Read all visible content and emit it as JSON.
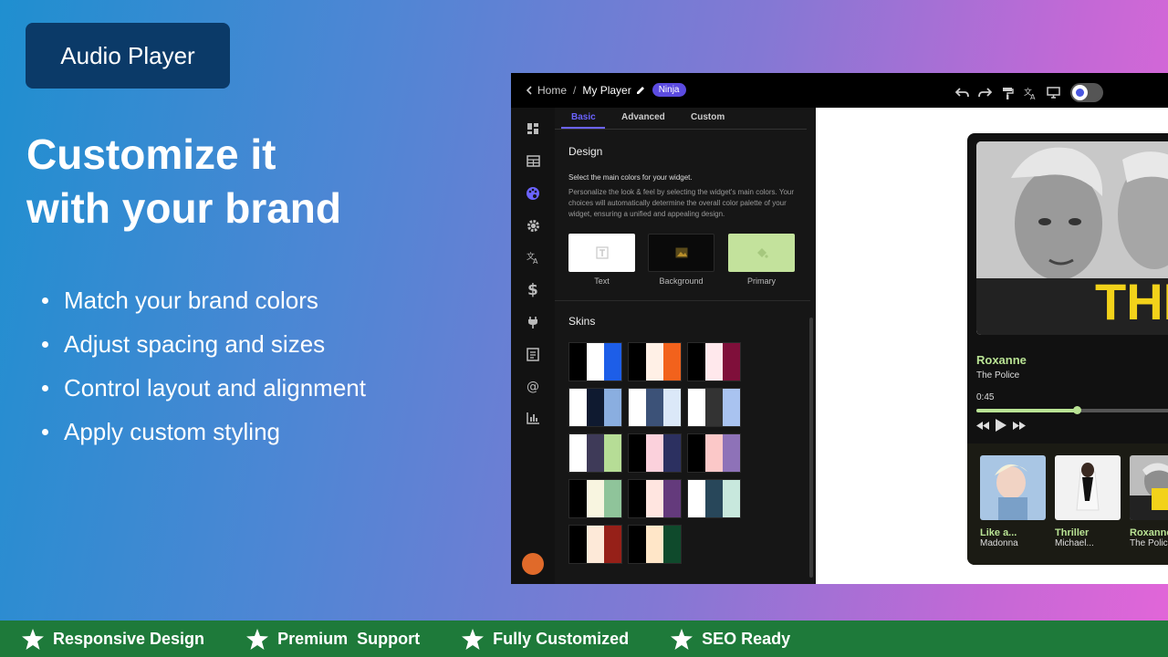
{
  "badge": {
    "label": "Audio Player"
  },
  "headline": {
    "line1": "Customize it",
    "line2": "with your brand"
  },
  "bullets": [
    "Match your brand colors",
    "Adjust spacing and sizes",
    "Control layout and alignment",
    "Apply custom styling"
  ],
  "footer": {
    "features": [
      "Responsive Design",
      "Premium  Support",
      "Fully Customized",
      "SEO Ready"
    ]
  },
  "app": {
    "breadcrumb": {
      "home": "Home",
      "separator": "/",
      "current": "My Player",
      "plan_badge": "Ninja"
    },
    "toolbar_icons": [
      "undo-icon",
      "redo-icon",
      "paint-roller-icon",
      "translate-icon",
      "desktop-icon",
      "dark-mode-toggle"
    ],
    "sidebar_icons": [
      "dashboard-icon",
      "layout-icon",
      "palette-icon",
      "gear-icon",
      "translate-icon",
      "dollar-icon",
      "plug-icon",
      "form-icon",
      "at-icon",
      "analytics-icon"
    ],
    "tabs": [
      "Basic",
      "Advanced",
      "Custom"
    ],
    "active_tab": "Basic",
    "design": {
      "title": "Design",
      "subtitle": "Select the main colors for your widget.",
      "description": "Personalize the look & feel by selecting the widget's main colors. Your choices will automatically determine the overall color palette of your widget, ensuring a unified and appealing design.",
      "swatches": [
        {
          "label": "Text",
          "color": "#ffffff"
        },
        {
          "label": "Background",
          "color": "#0a0a0a"
        },
        {
          "label": "Primary",
          "color": "#c3e29c"
        }
      ]
    },
    "skins": {
      "title": "Skins",
      "palettes": [
        [
          "#000000",
          "#ffffff",
          "#1d5ee8"
        ],
        [
          "#000000",
          "#fff0e6",
          "#f2621c"
        ],
        [
          "#000000",
          "#ffe8ec",
          "#7f0f3a"
        ],
        [
          "#ffffff",
          "#0f1a30",
          "#8aaee0"
        ],
        [
          "#ffffff",
          "#3c5278",
          "#dbe8f8"
        ],
        [
          "#ffffff",
          "#333333",
          "#a9c3f0"
        ],
        [
          "#ffffff",
          "#3e3a58",
          "#b6dd96"
        ],
        [
          "#000000",
          "#fbd1dc",
          "#2c3060"
        ],
        [
          "#000000",
          "#fbc8c8",
          "#8e72b8"
        ],
        [
          "#000000",
          "#f8f5e0",
          "#8fc49a"
        ],
        [
          "#000000",
          "#ffe5e0",
          "#643a7c"
        ],
        [
          "#ffffff",
          "#28475a",
          "#c8e8dd"
        ],
        [
          "#000000",
          "#fde9d8",
          "#962018"
        ],
        [
          "#000000",
          "#ffe6c8",
          "#0f4a2c"
        ]
      ]
    },
    "player": {
      "song": "Roxanne",
      "artist": "The Police",
      "time": "0:45",
      "progress": 0.5,
      "cover_text": "THE POLICE",
      "playlist": [
        {
          "title": "Like a...",
          "artist": "Madonna"
        },
        {
          "title": "Thriller",
          "artist": "Michael..."
        },
        {
          "title": "Roxanne",
          "artist": "The Polic"
        }
      ]
    }
  }
}
